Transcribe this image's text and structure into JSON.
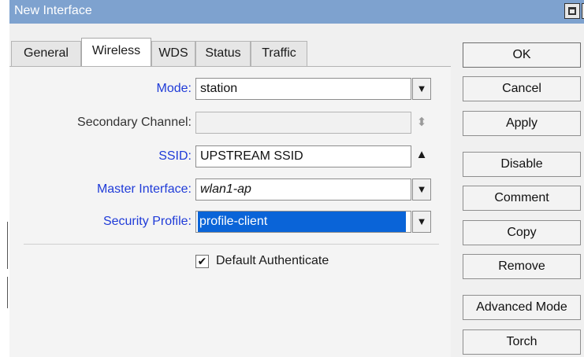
{
  "window": {
    "title": "New Interface"
  },
  "tabs": [
    {
      "label": "General",
      "active": false
    },
    {
      "label": "Wireless",
      "active": true
    },
    {
      "label": "WDS",
      "active": false
    },
    {
      "label": "Status",
      "active": false
    },
    {
      "label": "Traffic",
      "active": false
    }
  ],
  "form": {
    "mode": {
      "label": "Mode:",
      "value": "station"
    },
    "secondary_channel": {
      "label": "Secondary Channel:",
      "value": ""
    },
    "ssid": {
      "label": "SSID:",
      "value": "UPSTREAM SSID"
    },
    "master_interface": {
      "label": "Master Interface:",
      "value": "wlan1-ap"
    },
    "security_profile": {
      "label": "Security Profile:",
      "value": "profile-client"
    },
    "default_authenticate": {
      "label": "Default Authenticate",
      "checked": true
    }
  },
  "buttons": {
    "ok": "OK",
    "cancel": "Cancel",
    "apply": "Apply",
    "disable": "Disable",
    "comment": "Comment",
    "copy": "Copy",
    "remove": "Remove",
    "advanced_mode": "Advanced Mode",
    "torch": "Torch"
  },
  "icons": {
    "dropdown": "dropdown-arrow-icon",
    "spinner": "up-down-spinner-icon",
    "collapse": "up-arrow-icon",
    "check": "✔"
  },
  "colors": {
    "titlebar": "#7ea2cf",
    "label_highlight": "#1f3bd8",
    "selection": "#0a64d8"
  }
}
